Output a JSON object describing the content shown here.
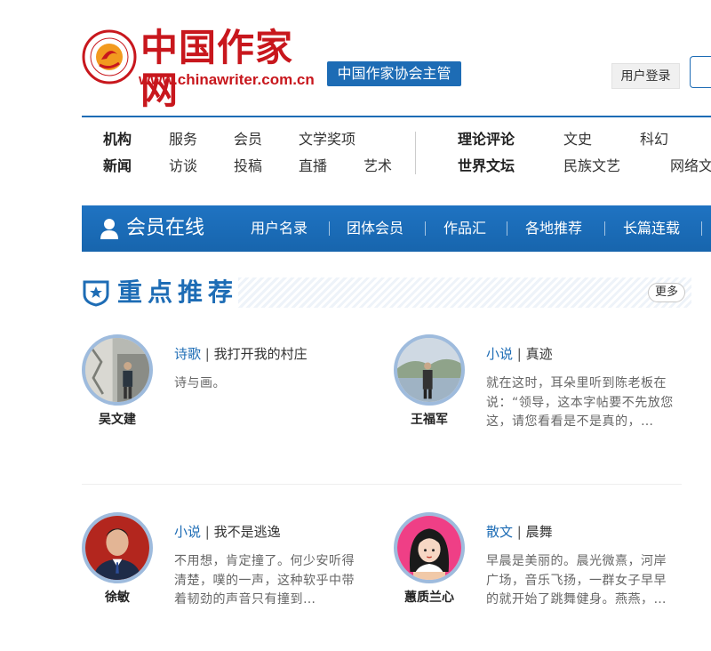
{
  "header": {
    "logo_text": "中国作家网",
    "logo_url": "www.chinawriter.com.cn",
    "org_badge": "中国作家协会主管",
    "login_label": "用户登录"
  },
  "nav": {
    "row1": [
      "机构",
      "服务",
      "会员",
      "文学奖项",
      "理论评论",
      "文史",
      "科幻"
    ],
    "row2": [
      "新闻",
      "访谈",
      "投稿",
      "直播",
      "艺术",
      "世界文坛",
      "民族文艺",
      "网络文"
    ]
  },
  "member_bar": {
    "title": "会员在线",
    "links": [
      "用户名录",
      "团体会员",
      "作品汇",
      "各地推荐",
      "长篇连载"
    ]
  },
  "section": {
    "title": "重点推荐",
    "more_label": "更多"
  },
  "cards": [
    {
      "author": "吴文建",
      "category": "诗歌",
      "separator": "|",
      "title": "我打开我的村庄",
      "summary": "诗与画。"
    },
    {
      "author": "王福军",
      "category": "小说",
      "separator": "|",
      "title": "真迹",
      "summary": "就在这时，耳朵里听到陈老板在说：“领导，这本字帖要不先放您这，请您看看是不是真的，…"
    },
    {
      "author": "徐敏",
      "category": "小说",
      "separator": "|",
      "title": "我不是逃逸",
      "summary": "不用想，肯定撞了。何少安听得清楚，噗的一声，这种软乎中带着韧劲的声音只有撞到…"
    },
    {
      "author": "蕙质兰心",
      "category": "散文",
      "separator": "|",
      "title": "晨舞",
      "summary": "早晨是美丽的。晨光微熹，河岸广场，音乐飞扬，一群女子早早的就开始了跳舞健身。燕燕，…"
    }
  ],
  "colors": {
    "brand_red": "#c8171d",
    "brand_blue": "#1d6cb5",
    "avatar_ring": "#9ebbdd"
  }
}
